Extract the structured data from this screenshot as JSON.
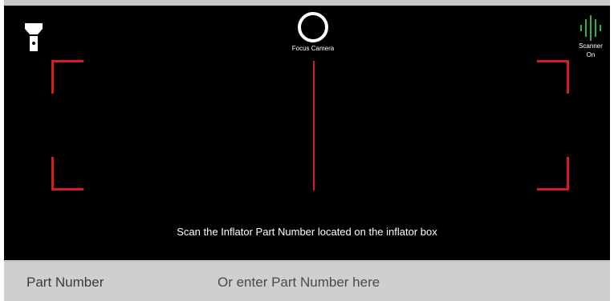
{
  "camera": {
    "focus_label": "Focus Camera",
    "scanner_label_line1": "Scanner",
    "scanner_label_line2": "On",
    "instruction": "Scan the Inflator Part Number located on the inflator box",
    "frame_color": "#d81c1c",
    "scanner_color": "#2fb34a"
  },
  "part_entry": {
    "label": "Part Number",
    "placeholder": "Or enter Part Number here",
    "value": ""
  }
}
